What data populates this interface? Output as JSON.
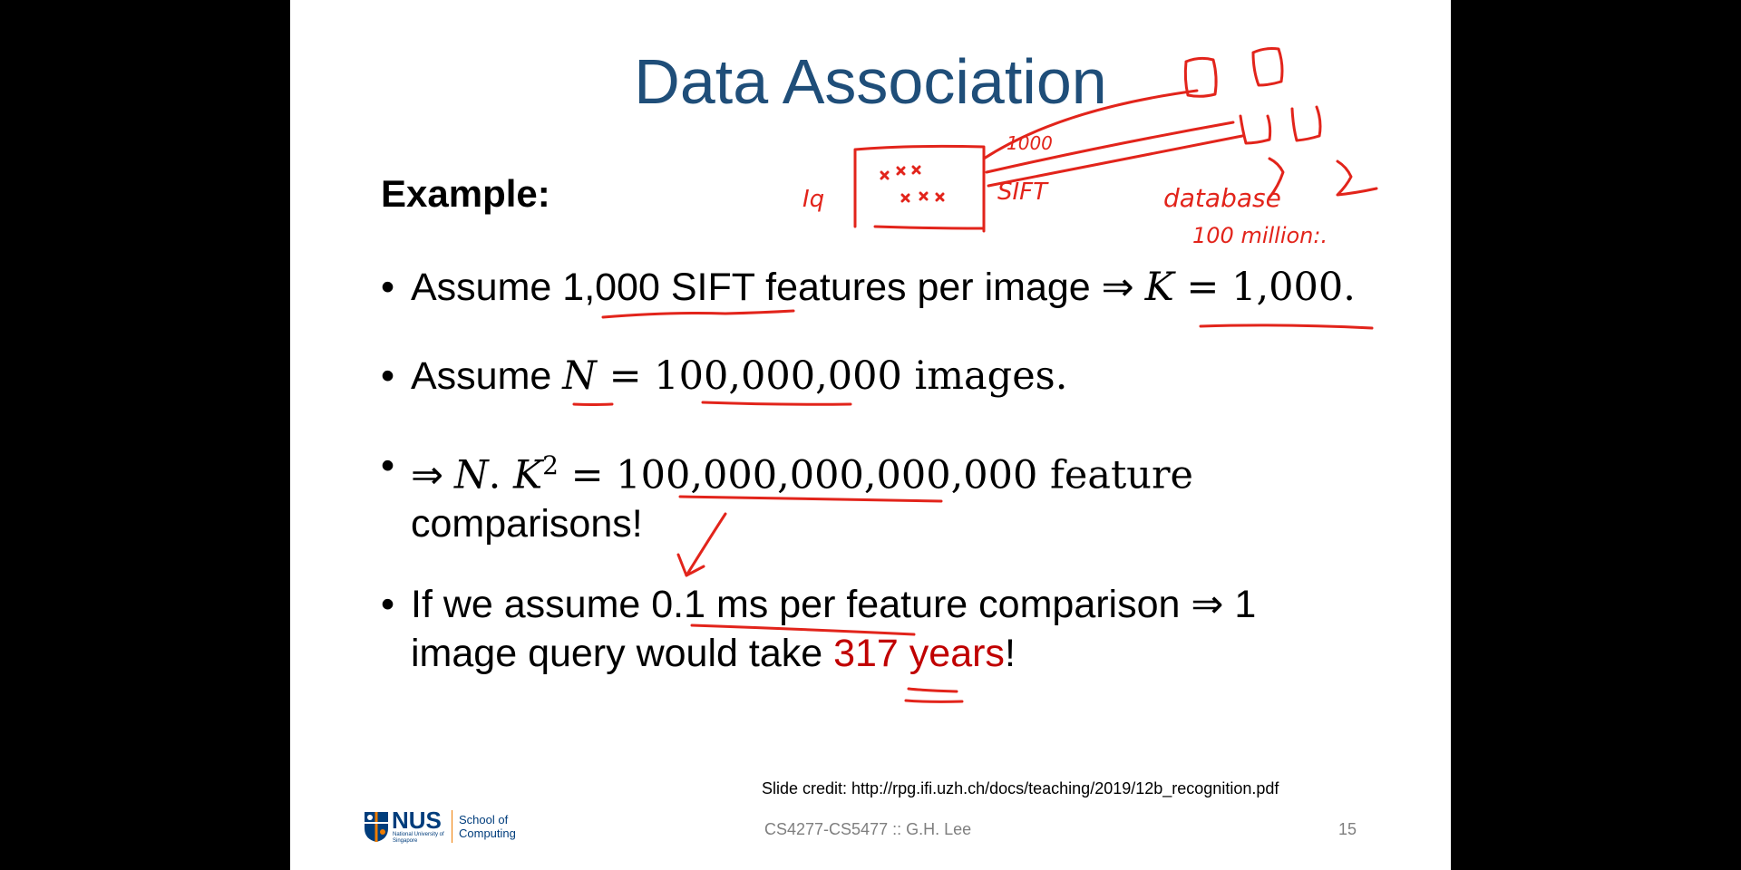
{
  "slide": {
    "title": "Data Association",
    "example_label": "Example:",
    "bullet_symbol": "•",
    "bullets": [
      {
        "p1": "Assume 1,000 SIFT features per image ⇒ ",
        "m1": "K",
        "p2": " = 1,000."
      },
      {
        "p1": "Assume ",
        "m1": "N",
        "p2": " = 100,000,000 images."
      },
      {
        "p1": "⇒ ",
        "m1": "N",
        "m2": ". ",
        "m3": "K",
        "sup": "2",
        "p2": " = 100,000,000,000,000 feature",
        "line2": "comparisons!"
      },
      {
        "line1": "If we assume 0.1 ms per feature comparison ⇒ 1",
        "line2a": "image query would take ",
        "line2_red": "317 years",
        "line2b": "!"
      }
    ],
    "credit": "Slide credit: http://rpg.ifi.uzh.ch/docs/teaching/2019/12b_recognition.pdf",
    "footer": "CS4277-CS5477 :: G.H. Lee",
    "page_number": "15",
    "logo": {
      "name": "NUS",
      "subtitle": "National University of Singapore",
      "school": "School of",
      "school2": "Computing"
    }
  },
  "annotations": {
    "ink_color": "#e2241b",
    "iq": "Iq",
    "sift": "SIFT",
    "count": "1000",
    "database": "database",
    "millions": "100 million:."
  },
  "colors": {
    "title": "#1f4e79",
    "highlight": "#c00000",
    "background": "#000000"
  }
}
